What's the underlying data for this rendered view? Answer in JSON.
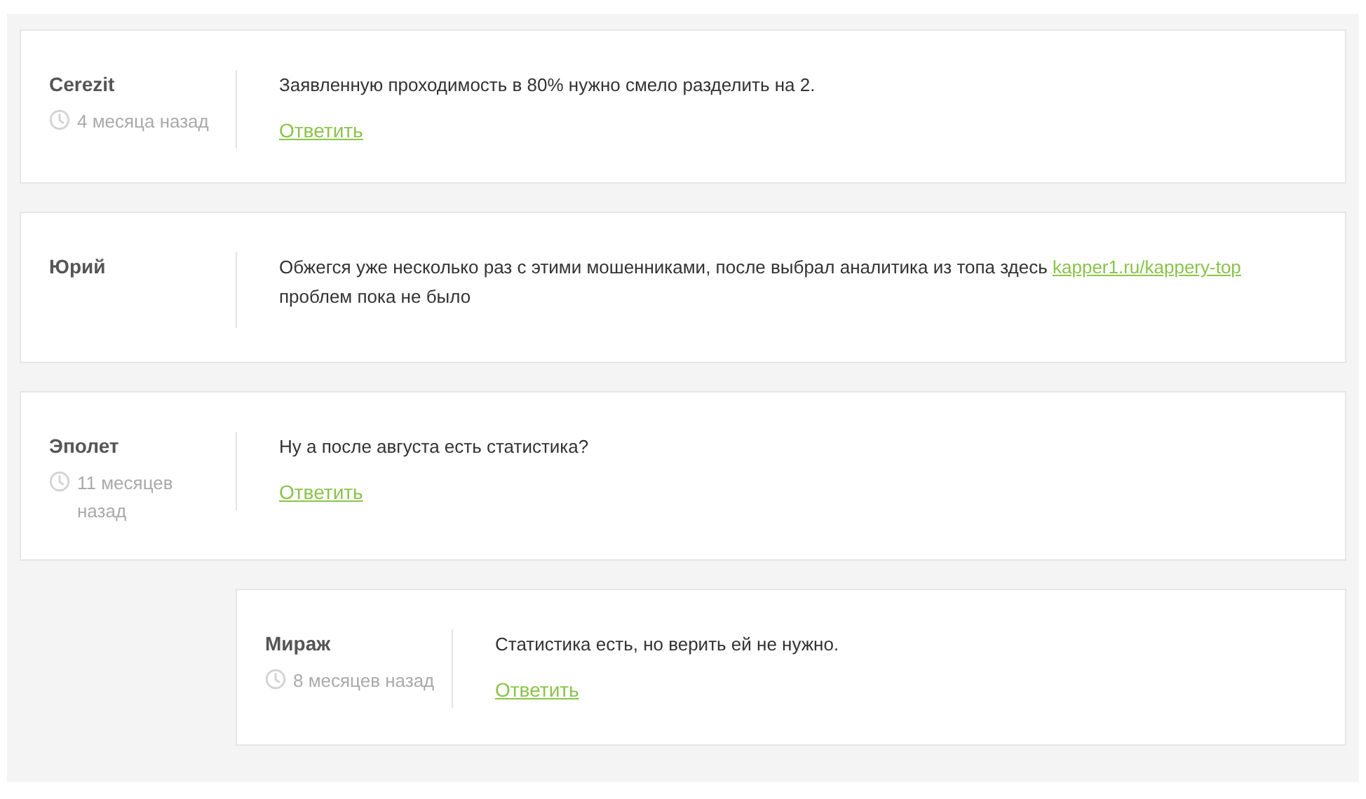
{
  "comments": [
    {
      "author": "Cerezit",
      "time": "4 месяца назад",
      "body": [
        {
          "kind": "text",
          "text": "Заявленную проходимость в 80% нужно смело разделить на 2."
        }
      ],
      "reply": "Ответить"
    },
    {
      "author": "Юрий",
      "body": [
        {
          "kind": "text",
          "text": "Обжегся уже несколько раз с этими мошенниками, после выбрал аналитика из топа здесь "
        },
        {
          "kind": "link",
          "text": "kapper1.ru/kappery-top"
        },
        {
          "kind": "text",
          "text": " проблем пока не было"
        }
      ]
    },
    {
      "author": "Эполет",
      "time": "11 месяцев назад",
      "body": [
        {
          "kind": "text",
          "text": "Ну а после августа есть статистика?"
        }
      ],
      "reply": "Ответить",
      "children": [
        {
          "author": "Мираж",
          "time": "8 месяцев назад",
          "body": [
            {
              "kind": "text",
              "text": "Статистика есть, но верить ей не нужно."
            }
          ],
          "reply": "Ответить"
        }
      ]
    }
  ]
}
